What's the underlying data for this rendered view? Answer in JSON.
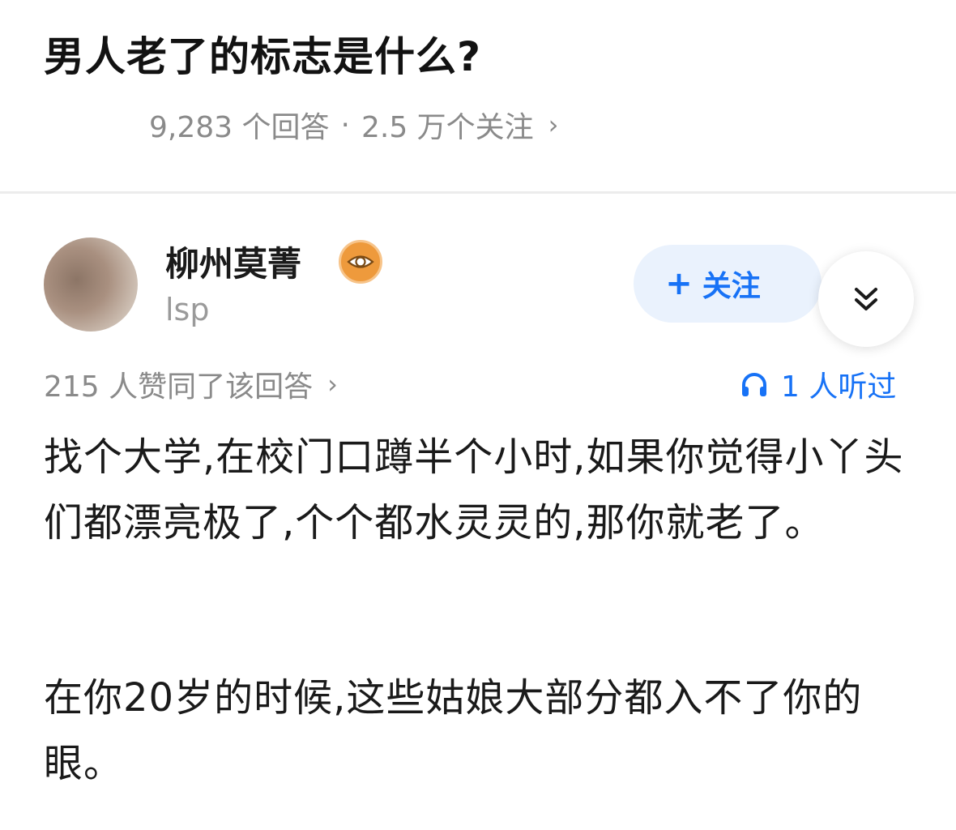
{
  "question": {
    "title": "男人老了的标志是什么?",
    "answers_count": "9,283 个回答",
    "separator": "·",
    "followers": "2.5 万个关注",
    "chevron": "›"
  },
  "author": {
    "name": "柳州莫菁",
    "badge_icon": "eye-badge-icon",
    "bio": "lsp",
    "follow_plus": "+",
    "follow_label": "关注",
    "expand_icon": "double-chevron-down-icon"
  },
  "meta": {
    "likes": "215 人赞同了该回答",
    "likes_chevron": "›",
    "listeners_icon": "headphone-icon",
    "listeners": "1 人听过"
  },
  "answer": {
    "paragraph_1": "找个大学,在校门口蹲半个小时,如果你觉得小丫头们都漂亮极了,个个都水灵灵的,那你就老了。",
    "paragraph_2": "在你20岁的时候,这些姑娘大部分都入不了你的眼。"
  },
  "colors": {
    "accent": "#1772f6",
    "follow_bg": "#eaf2fd",
    "badge": "#ee9a3c",
    "muted_text": "#8a8a8a"
  }
}
